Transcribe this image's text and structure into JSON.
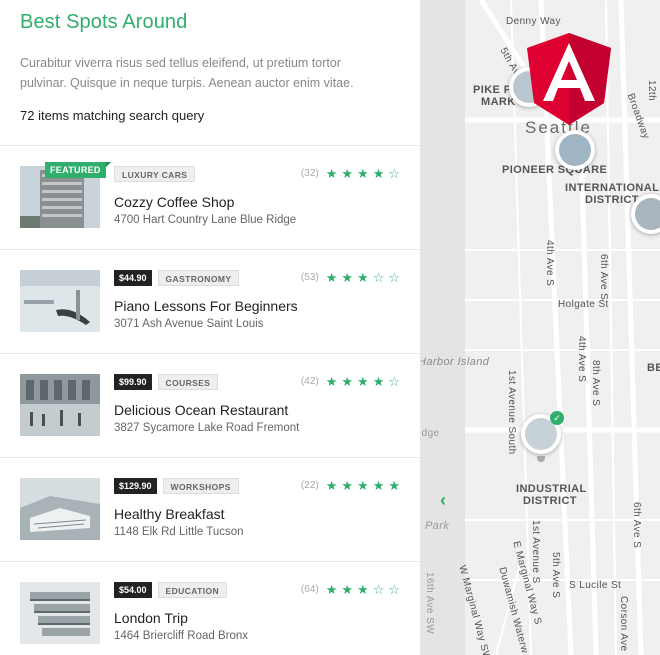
{
  "header": {
    "title": "Best Spots Around",
    "description": "Curabitur viverra risus sed tellus eleifend, ut pretium tortor pulvinar. Quisque in neque turpis. Aenean auctor enim vitae.",
    "result_count": "72 items matching search query"
  },
  "colors": {
    "accent": "#2fae6c",
    "dark_badge": "#222222"
  },
  "listings": [
    {
      "featured": "FEATURED",
      "price": "",
      "category": "LUXURY CARS",
      "name": "Cozzy Coffee Shop",
      "address": "4700 Hart Country Lane Blue Ridge",
      "reviews": "(32)",
      "rating": 4
    },
    {
      "featured": "",
      "price": "$44.90",
      "category": "GASTRONOMY",
      "name": "Piano Lessons For Beginners",
      "address": "3071 Ash Avenue Saint Louis",
      "reviews": "(53)",
      "rating": 3
    },
    {
      "featured": "",
      "price": "$99.90",
      "category": "COURSES",
      "name": "Delicious Ocean Restaurant",
      "address": "3827 Sycamore Lake Road Fremont",
      "reviews": "(42)",
      "rating": 4
    },
    {
      "featured": "",
      "price": "$129.90",
      "category": "WORKSHOPS",
      "name": "Healthy Breakfast",
      "address": "1148 Elk Rd Little Tucson",
      "reviews": "(22)",
      "rating": 5
    },
    {
      "featured": "",
      "price": "$54.00",
      "category": "EDUCATION",
      "name": "London Trip",
      "address": "1464 Briercliff Road Bronx",
      "reviews": "(64)",
      "rating": 3
    }
  ],
  "map": {
    "toggle_icon": "chevron-left-icon",
    "labels": {
      "denny_way": "Denny Way",
      "pike_place": "PIKE P",
      "pike_place_2": "MARK",
      "seattle": "Seattle",
      "pioneer_square": "PIONEER SQUARE",
      "international": "INTERNATIONAL",
      "district": "DISTRICT",
      "industrial": "INDUSTRIAL",
      "industrial_district": "DISTRICT",
      "harbor_island": "Harbor Island",
      "holgate": "Holgate St",
      "lucile": "S Lucile St",
      "first_ave": "1st Avenue South",
      "fourth_ave": "4th Ave S",
      "sixth_ave": "6th Ave S",
      "broadway": "Broadway",
      "fifth_ave": "5th Av",
      "twelfth": "12th",
      "park": "Park",
      "bridge": "idge",
      "be": "BE",
      "e_marginal": "E Marginal Way S",
      "duwamish": "Duwamish Waterw",
      "w_marginal": "W Marginal Way SW",
      "sixteenth": "16th Ave SW",
      "corson": "Corson Ave",
      "fifth_s": "5th Ave S",
      "eighth_s": "8th Ave S",
      "first_s": "1st Avenue S",
      "fourth_s": "4th Ave S"
    }
  }
}
